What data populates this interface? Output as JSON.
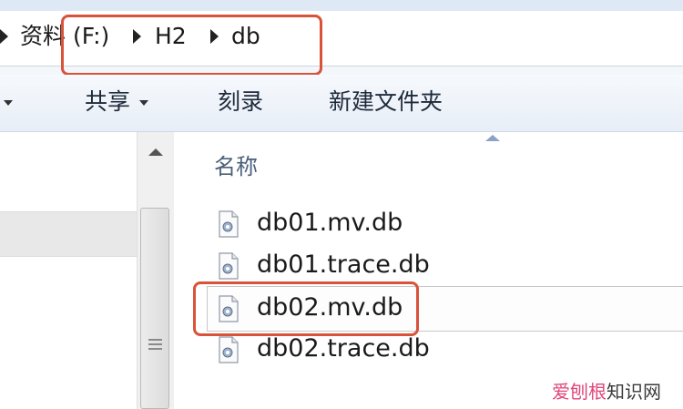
{
  "address_bar": {
    "segments": [
      {
        "label": "资料 (F:)"
      },
      {
        "label": "H2"
      },
      {
        "label": "db"
      }
    ],
    "highlight_color": "#d9533b"
  },
  "toolbar": {
    "share_label": "共享",
    "burn_label": "刻录",
    "new_folder_label": "新建文件夹"
  },
  "file_list": {
    "column_name": "名称",
    "files": [
      {
        "name": "db01.mv.db"
      },
      {
        "name": "db01.trace.db"
      },
      {
        "name": "db02.mv.db",
        "selected": true
      },
      {
        "name": "db02.trace.db"
      }
    ]
  },
  "watermark": {
    "brand": "爱刨根",
    "suffix": "知识网"
  },
  "colors": {
    "highlight": "#d9533b",
    "toolbar_text": "#1e2a3a",
    "header_text": "#4c607a"
  }
}
